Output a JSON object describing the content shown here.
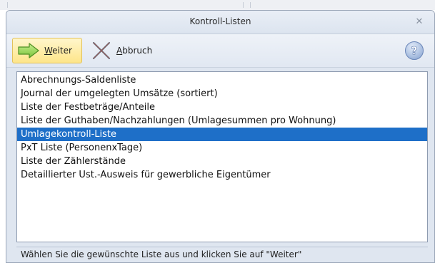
{
  "window": {
    "title": "Kontroll-Listen",
    "close_glyph": "✕"
  },
  "toolbar": {
    "weiter_label": "Weiter",
    "abbruch_label": "Abbruch",
    "help_glyph": "?"
  },
  "list": {
    "items": [
      "Abrechnungs-Saldenliste",
      "Journal der umgelegten Umsätze (sortiert)",
      "Liste der Festbeträge/Anteile",
      "Liste der Guthaben/Nachzahlungen (Umlagesummen pro Wohnung)",
      "Umlagekontroll-Liste",
      "PxT Liste (PersonenxTage)",
      "Liste der Zählerstände",
      "Detaillierter Ust.-Ausweis für gewerbliche Eigentümer"
    ],
    "selected_index": 4
  },
  "status": {
    "text": "Wählen Sie die gewünschte Liste aus und klicken Sie auf \"Weiter\""
  },
  "colors": {
    "selection": "#1e6fc8",
    "weiter_button": "#fde58a",
    "arrow_green": "#8fd14f"
  },
  "icons": {
    "weiter": "arrow-right-icon",
    "abbruch": "cross-icon",
    "help": "help-icon",
    "close": "close-icon"
  }
}
